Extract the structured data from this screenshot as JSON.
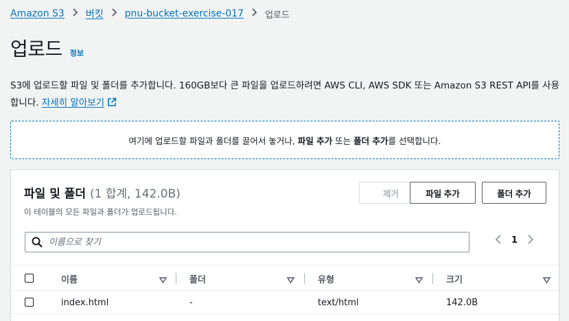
{
  "breadcrumb": {
    "items": [
      "Amazon S3",
      "버킷",
      "pnu-bucket-exercise-017"
    ],
    "current": "업로드"
  },
  "header": {
    "title": "업로드",
    "info_label": "정보"
  },
  "description": {
    "text": "S3에 업로드할 파일 및 폴더를 추가합니다. 160GB보다 큰 파일을 업로드하려면 AWS CLI, AWS SDK 또는 Amazon S3 REST API를 사용합니다. ",
    "learn_more": "자세히 알아보기",
    "learn_more_icon": "external-link-icon"
  },
  "dropzone": {
    "prefix": "여기에 업로드할 파일과 폴더를 끌어서 놓거나, ",
    "add_files": "파일 추가",
    "or": " 또는 ",
    "add_folder": "폴더 추가",
    "suffix": "를 선택합니다."
  },
  "files_panel": {
    "title": "파일 및 폴더",
    "count": "(1 합계, 142.0B)",
    "subtitle": "이 테이블의 모든 파일과 폴더가 업로드됩니다.",
    "remove_label": "제거",
    "add_files_label": "파일 추가",
    "add_folder_label": "폴더 추가",
    "search_placeholder": "이름으로 찾기",
    "search_value": "",
    "page": "1",
    "columns": [
      "이름",
      "폴더",
      "유형",
      "크기"
    ],
    "rows": [
      {
        "name": "index.html",
        "folder": "-",
        "type": "text/html",
        "size": "142.0B"
      }
    ]
  },
  "colors": {
    "link": "#0073bb",
    "background": "#f2f3f3",
    "panel": "#ffffff",
    "text": "#16191f",
    "muted": "#545b64",
    "disabled": "#aab7b8"
  }
}
